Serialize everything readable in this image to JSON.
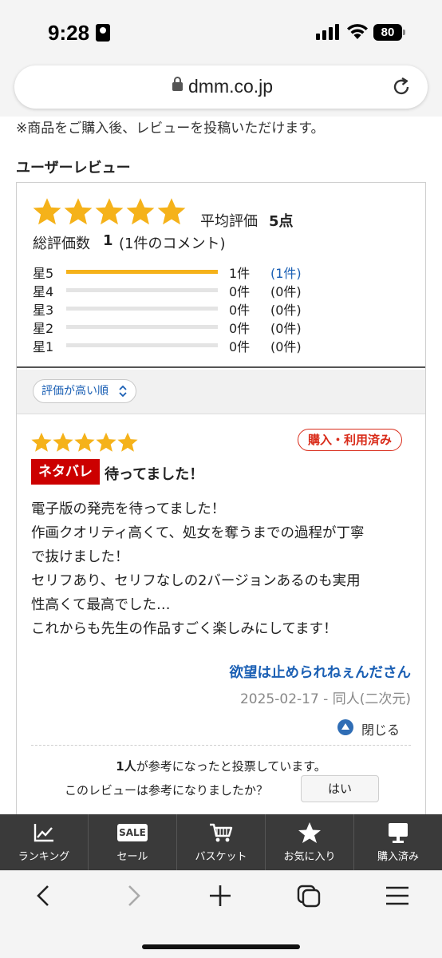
{
  "status_bar": {
    "time": "9:28",
    "battery": "80"
  },
  "browser": {
    "url": "dmm.co.jp"
  },
  "notice": "※商品をご購入後、レビューを投稿いただけます。",
  "section_title": "ユーザーレビュー",
  "summary": {
    "rating": 5,
    "avg_label": "平均評価",
    "avg_value": "5点",
    "total_label": "総評価数",
    "total_value": "1",
    "total_comment": "(1件のコメント)",
    "distribution": [
      {
        "label": "星5",
        "count": "1件",
        "comments": "(1件)",
        "fraction": 1.0
      },
      {
        "label": "星4",
        "count": "0件",
        "comments": "(0件)",
        "fraction": 0
      },
      {
        "label": "星3",
        "count": "0件",
        "comments": "(0件)",
        "fraction": 0
      },
      {
        "label": "星2",
        "count": "0件",
        "comments": "(0件)",
        "fraction": 0
      },
      {
        "label": "星1",
        "count": "0件",
        "comments": "(0件)",
        "fraction": 0
      }
    ]
  },
  "sort": {
    "selected": "評価が高い順"
  },
  "review": {
    "rating": 5,
    "purchased_badge": "購入・利用済み",
    "spoiler_badge": "ネタバレ",
    "title": "待ってました！",
    "body": [
      "電子版の発売を待ってました！",
      "作画クオリティ高くて、処女を奪うまでの過程が丁寧",
      "で抜けました！",
      "セリフあり、セリフなしの2バージョンあるのも実用",
      "性高くて最高でした…",
      "これからも先生の作品すごく楽しみにしてます！"
    ],
    "author": "欲望は止められねぇんださん",
    "meta": "2025-02-17 - 同人(二次元)",
    "collapse_label": "閉じる",
    "vote_count": "1人",
    "vote_text": "が参考になったと投票しています。",
    "vote_question": "このレビューは参考になりましたか？",
    "yes_label": "はい"
  },
  "bottom_nav": [
    {
      "label": "ランキング",
      "icon": "ranking-chart-icon"
    },
    {
      "label": "セール",
      "icon": "sale-icon",
      "icon_text": "SALE"
    },
    {
      "label": "バスケット",
      "icon": "cart-icon"
    },
    {
      "label": "お気に入り",
      "icon": "star-icon"
    },
    {
      "label": "購入済み",
      "icon": "monitor-icon"
    }
  ],
  "colors": {
    "star": "#F5B21A",
    "link": "#1A5FB4",
    "badge_red": "#CC0000",
    "nav_bg": "#3A3A3A"
  }
}
